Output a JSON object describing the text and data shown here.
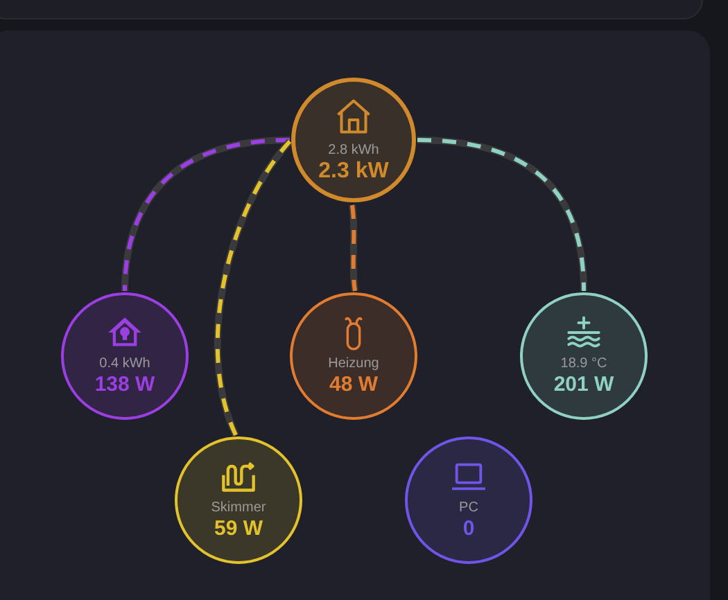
{
  "nodes": [
    {
      "kind": "home",
      "secondary": "2.8 kWh",
      "value": "2.3 kW",
      "color": "#d08a2c"
    },
    {
      "kind": "device",
      "secondary": "0.4 kWh",
      "value": "138 W",
      "color": "#9b3fe3",
      "connected": true
    },
    {
      "kind": "device",
      "secondary": "Heizung",
      "value": "48 W",
      "color": "#e27c30",
      "connected": true
    },
    {
      "kind": "device",
      "secondary": "18.9 °C",
      "value": "201 W",
      "color": "#8fd2c4",
      "connected": true
    },
    {
      "kind": "device",
      "secondary": "Skimmer",
      "value": "59 W",
      "color": "#e3c22c",
      "connected": true
    },
    {
      "kind": "device",
      "secondary": "PC",
      "value": "0",
      "color": "#7055e8",
      "connected": false
    }
  ]
}
